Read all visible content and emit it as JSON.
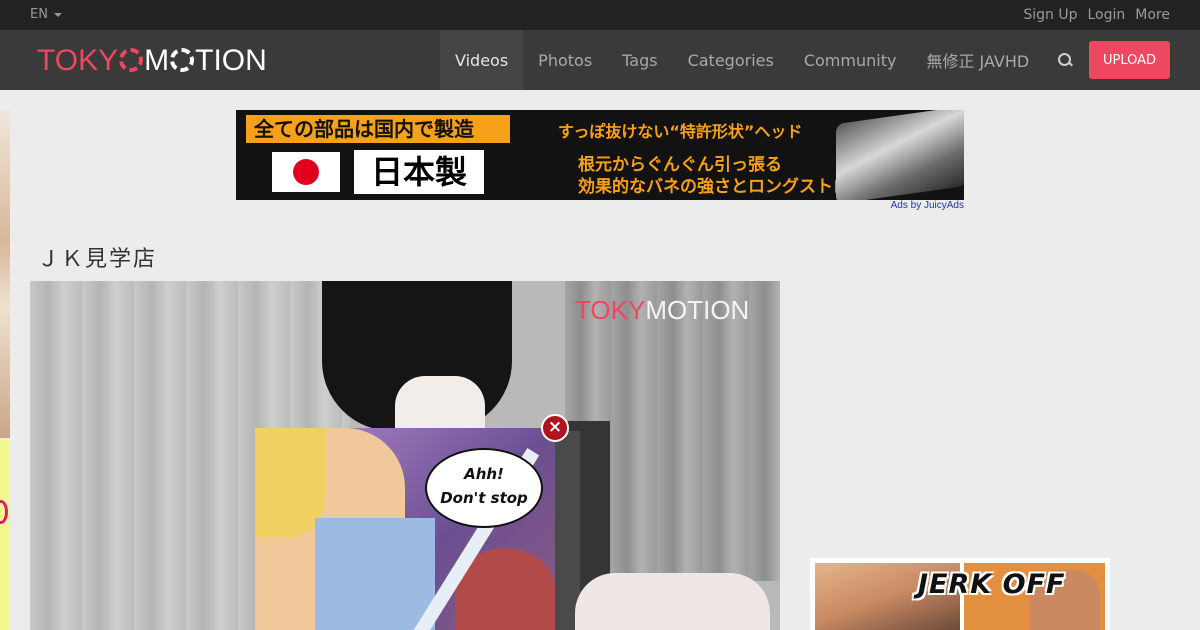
{
  "topbar": {
    "language": "EN",
    "links": [
      "Sign Up",
      "Login",
      "More"
    ]
  },
  "navbar": {
    "logo_part1": "TOKY",
    "logo_part2": "M",
    "logo_part3": "TION",
    "items": [
      "Videos",
      "Photos",
      "Tags",
      "Categories",
      "Community",
      "無修正 JAVHD"
    ],
    "active_item": "Videos",
    "upload_label": "UPLOAD",
    "search_icon": "search-icon"
  },
  "banner_ad": {
    "headline": "全ての部品は国内で製造",
    "made_in": "日本製",
    "line1": "すっぽ抜けない“特許形状”ヘッド",
    "line2": "根元からぐんぐん引っ張る",
    "line3": "効果的なバネの強さとロングストローク",
    "attribution": "Ads by JuicyAds"
  },
  "video": {
    "title": "ＪＫ見学店",
    "watermark_part1": "TOKY",
    "watermark_part2": "MOTION"
  },
  "popup_ad": {
    "bubble_line1": "Ahh!",
    "bubble_line2": "Don't stop",
    "close_label": "×"
  },
  "right_ad": {
    "text": "JERK OFF"
  },
  "colors": {
    "brand": "#ee4760",
    "topbar": "#222222",
    "navbar": "#3a3a3a",
    "background": "#ececec"
  }
}
